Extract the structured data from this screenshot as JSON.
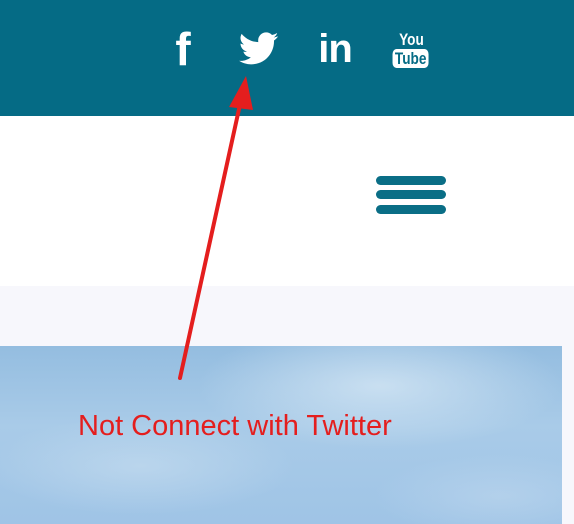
{
  "social_bar": {
    "background": "#056b85",
    "icons": [
      {
        "name": "facebook-icon",
        "glyph": "f"
      },
      {
        "name": "twitter-icon"
      },
      {
        "name": "linkedin-icon",
        "glyph": "in"
      },
      {
        "name": "youtube-icon",
        "top_text": "You",
        "bottom_text": "Tube"
      }
    ]
  },
  "header": {
    "menu_icon": "hamburger-menu-icon",
    "menu_color": "#0a6e86"
  },
  "annotation": {
    "text": "Not Connect with Twitter",
    "color": "#e41e1e"
  }
}
